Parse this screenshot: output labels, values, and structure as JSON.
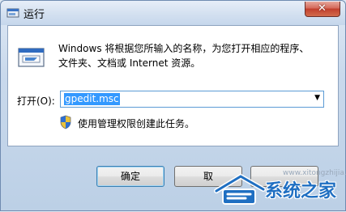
{
  "window": {
    "title": "运行",
    "close_icon": "close-icon"
  },
  "dialog": {
    "description_line1": "Windows 将根据您所输入的名称，为您打开相应的程序、",
    "description_line2": "文件夹、文档或 Internet 资源。",
    "open_label": "打开(O):",
    "open_value": "gpedit.msc",
    "admin_note": "使用管理权限创建此任务。"
  },
  "buttons": {
    "ok": "确定",
    "cancel": "取",
    "browse": ""
  },
  "watermark": {
    "text": "系统之家",
    "url": "www.xitongzhijia.net"
  },
  "colors": {
    "accent": "#3399ff",
    "watermark": "#1f6fc2"
  }
}
